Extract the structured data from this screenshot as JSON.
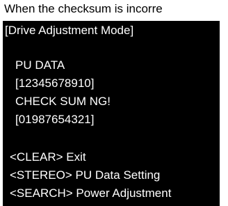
{
  "caption": "When the checksum is incorre",
  "screen": {
    "mode_title": "[Drive Adjustment Mode]",
    "data_label": "PU DATA",
    "data_value": "[12345678910]",
    "status": "CHECK SUM NG!",
    "checksum_value": "[01987654321]",
    "menu": [
      "<CLEAR> Exit",
      "<STEREO> PU Data Setting",
      "<SEARCH> Power Adjustment"
    ]
  }
}
